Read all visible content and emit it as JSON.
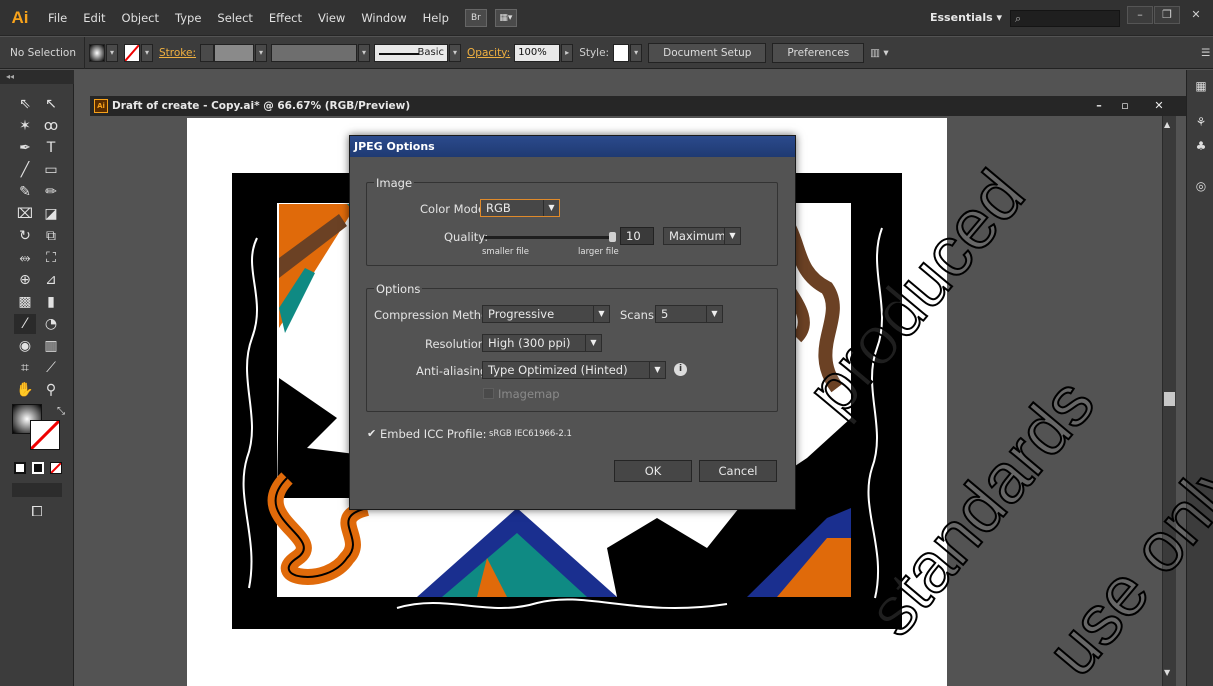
{
  "menubar": {
    "app_logo": "Ai",
    "items": [
      "File",
      "Edit",
      "Object",
      "Type",
      "Select",
      "Effect",
      "View",
      "Window",
      "Help"
    ],
    "bridge_icon_label": "Br",
    "workspace": "Essentials",
    "search_icon_glyph": "⌕"
  },
  "controlbar": {
    "selection": "No Selection",
    "stroke_label": "Stroke:",
    "brush_label": "Basic",
    "opacity_label": "Opacity:",
    "opacity_value": "100%",
    "style_label": "Style:",
    "document_setup": "Document Setup",
    "preferences": "Preferences"
  },
  "document": {
    "title": "Draft of create - Copy.ai* @ 66.67% (RGB/Preview)",
    "icon_label": "Ai"
  },
  "dialog": {
    "title": "JPEG Options",
    "image_group": {
      "title": "Image",
      "color_model_label": "Color Model:",
      "color_model_value": "RGB",
      "quality_label": "Quality:",
      "quality_value": "10",
      "quality_preset": "Maximum",
      "smaller_file": "smaller file",
      "larger_file": "larger file",
      "quality_fraction": 1.0
    },
    "options_group": {
      "title": "Options",
      "compression_label": "Compression Method:",
      "compression_value": "Progressive",
      "scans_label": "Scans:",
      "scans_value": "5",
      "resolution_label": "Resolution:",
      "resolution_value": "High (300 ppi)",
      "antialias_label": "Anti-aliasing:",
      "antialias_value": "Type Optimized (Hinted)",
      "imagemap_label": "Imagemap",
      "imagemap_checked": false
    },
    "embed_icc_label": "Embed ICC Profile:",
    "embed_icc_value": "sRGB IEC61966-2.1",
    "embed_icc_checked": true,
    "ok": "OK",
    "cancel": "Cancel"
  },
  "watermark": {
    "lines": [
      "produced",
      "standards",
      "use only"
    ]
  },
  "colors": {
    "art_orange": "#e06a0a",
    "art_teal": "#0f8a83",
    "art_navy": "#1a2f8f",
    "art_brown": "#6b4124",
    "art_black": "#000000"
  }
}
